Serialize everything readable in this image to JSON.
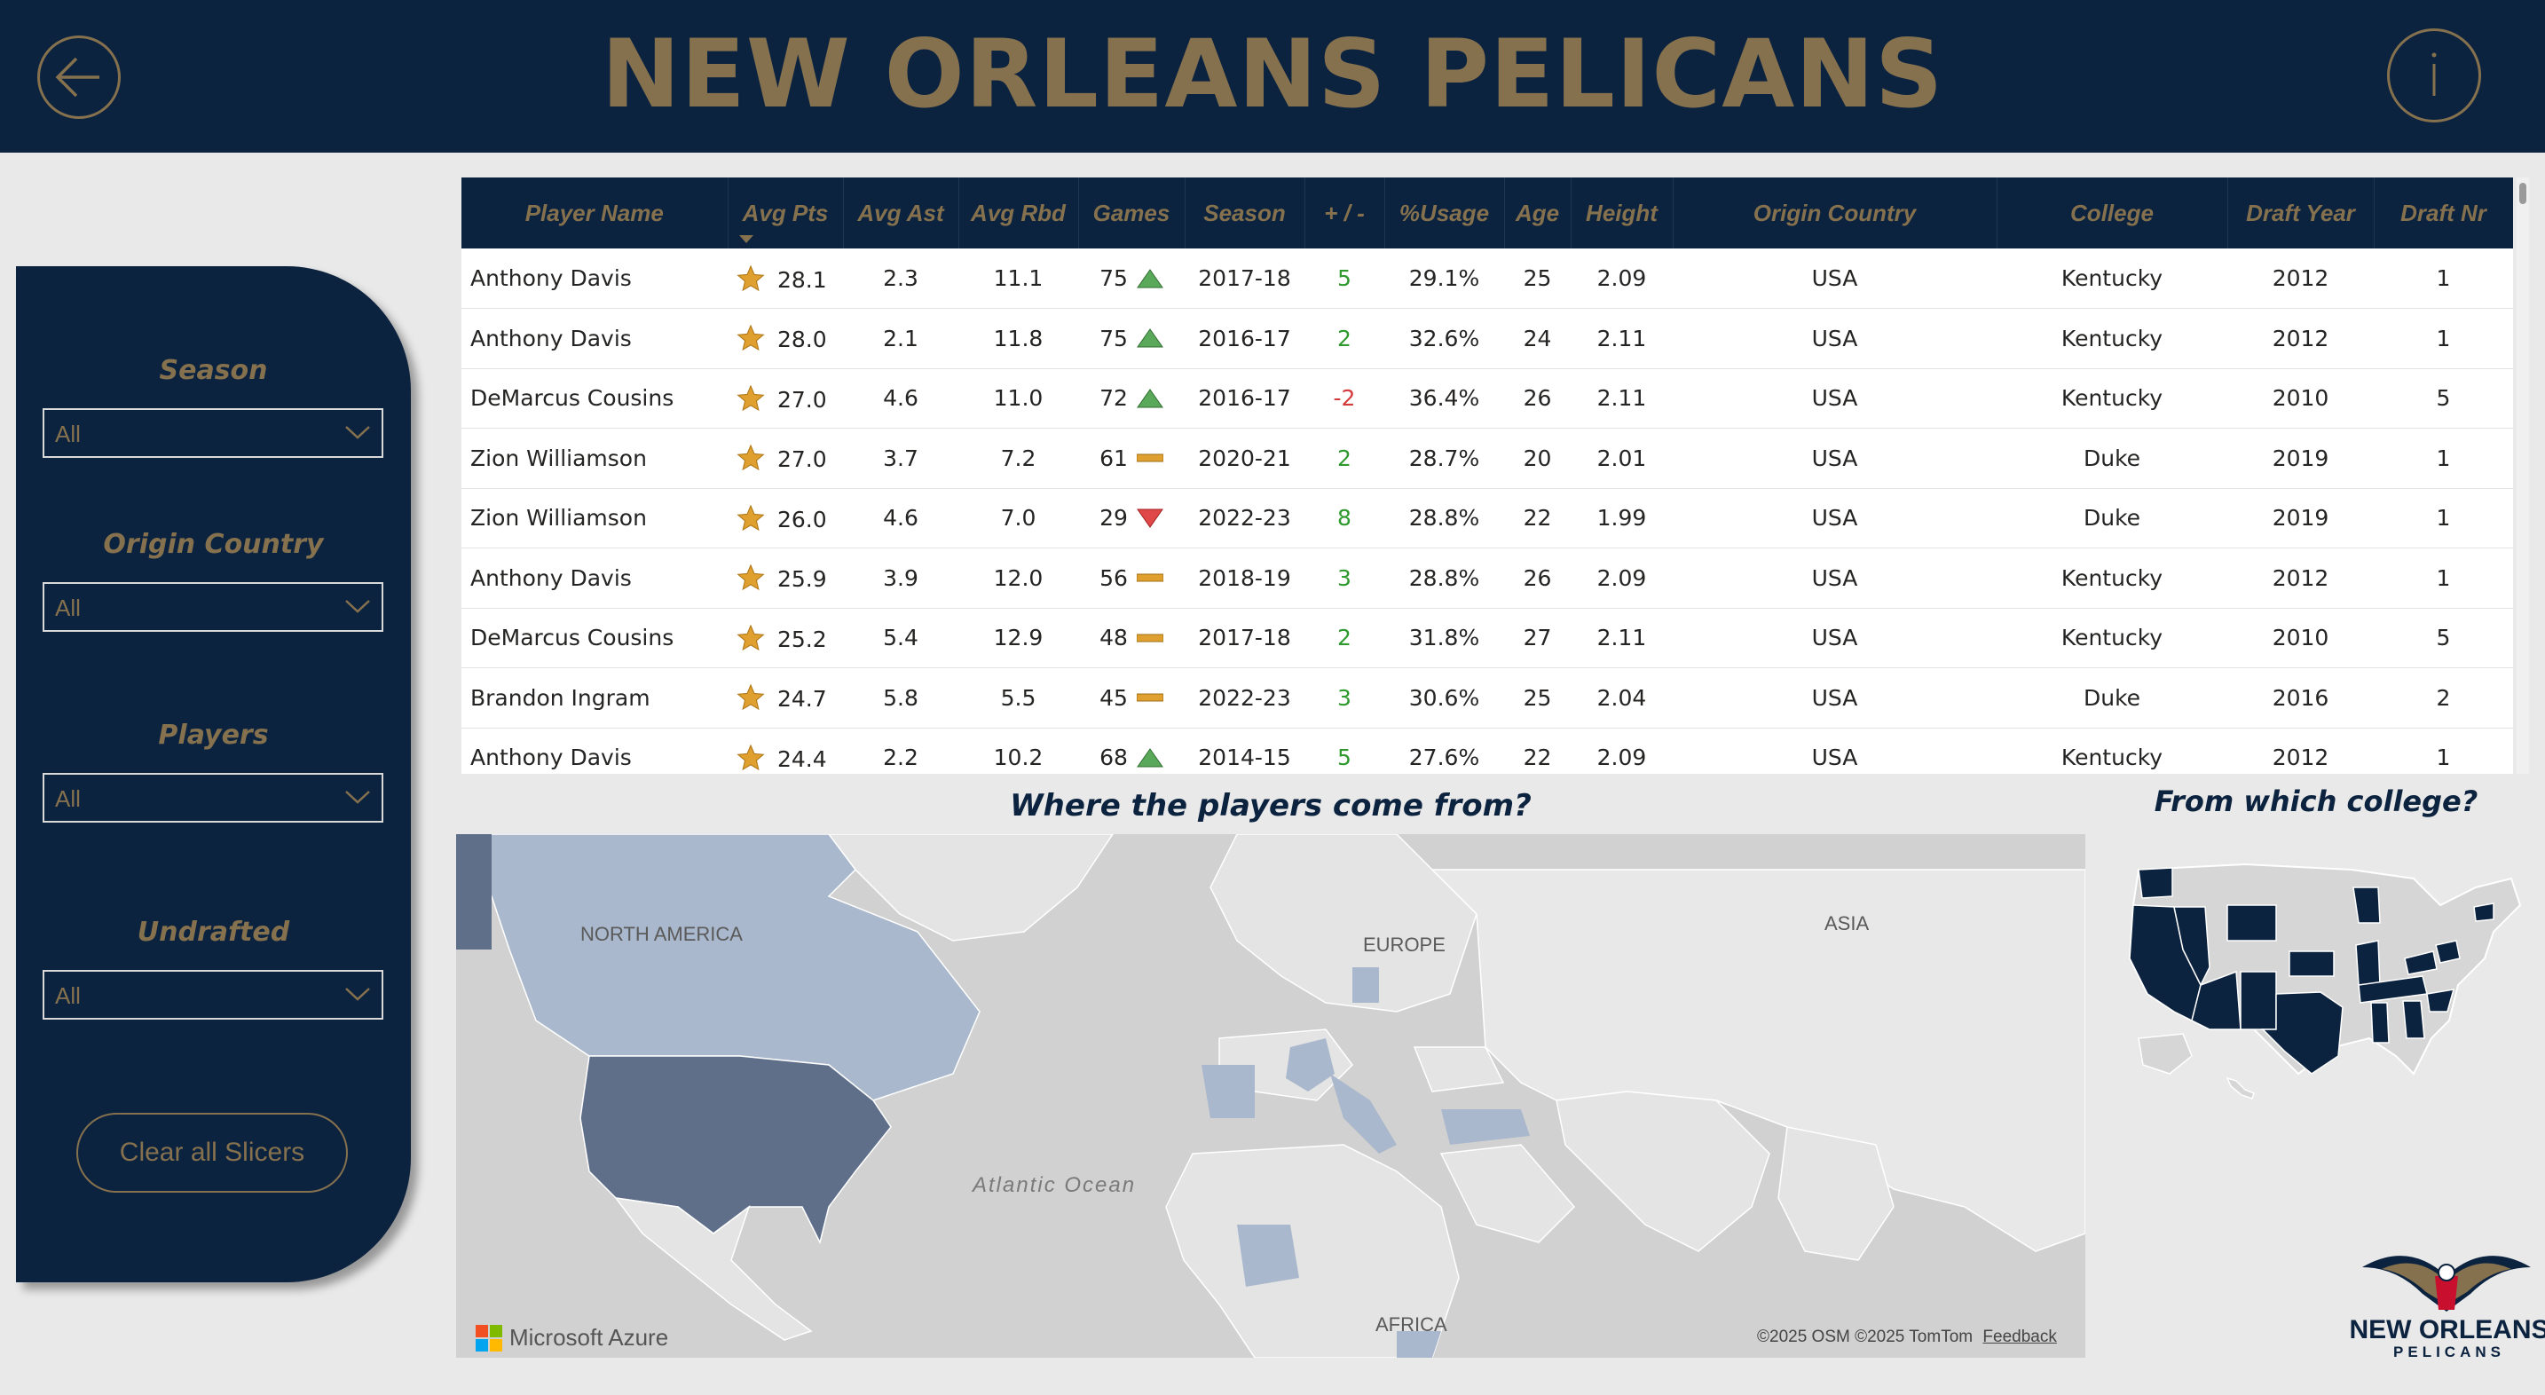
{
  "header": {
    "title": "NEW ORLEANS PELICANS",
    "back_icon": "back-arrow-icon",
    "info_icon": "info-icon"
  },
  "colors": {
    "navy": "#0c2340",
    "gold": "#85714d",
    "positive": "#2e9a2e",
    "negative": "#d43a3a"
  },
  "slicers": [
    {
      "label": "Season",
      "value": "All"
    },
    {
      "label": "Origin Country",
      "value": "All"
    },
    {
      "label": "Players",
      "value": "All"
    },
    {
      "label": "Undrafted",
      "value": "All"
    }
  ],
  "clear_button": "Clear all Slicers",
  "table": {
    "columns": [
      "Player Name",
      "Avg Pts",
      "Avg Ast",
      "Avg Rbd",
      "Games",
      "Season",
      "+ / -",
      "%Usage",
      "Age",
      "Height",
      "Origin Country",
      "College",
      "Draft Year",
      "Draft Nr"
    ],
    "rows": [
      {
        "player": "Anthony Davis",
        "pts": "28.1",
        "ast": "2.3",
        "rbd": "11.1",
        "games": "75",
        "trend": "up",
        "season": "2017-18",
        "pm": "5",
        "usage": "29.1%",
        "age": "25",
        "height": "2.09",
        "country": "USA",
        "college": "Kentucky",
        "draft_year": "2012",
        "draft_nr": "1"
      },
      {
        "player": "Anthony Davis",
        "pts": "28.0",
        "ast": "2.1",
        "rbd": "11.8",
        "games": "75",
        "trend": "up",
        "season": "2016-17",
        "pm": "2",
        "usage": "32.6%",
        "age": "24",
        "height": "2.11",
        "country": "USA",
        "college": "Kentucky",
        "draft_year": "2012",
        "draft_nr": "1"
      },
      {
        "player": "DeMarcus Cousins",
        "pts": "27.0",
        "ast": "4.6",
        "rbd": "11.0",
        "games": "72",
        "trend": "up",
        "season": "2016-17",
        "pm": "-2",
        "usage": "36.4%",
        "age": "26",
        "height": "2.11",
        "country": "USA",
        "college": "Kentucky",
        "draft_year": "2010",
        "draft_nr": "5"
      },
      {
        "player": "Zion Williamson",
        "pts": "27.0",
        "ast": "3.7",
        "rbd": "7.2",
        "games": "61",
        "trend": "flat",
        "season": "2020-21",
        "pm": "2",
        "usage": "28.7%",
        "age": "20",
        "height": "2.01",
        "country": "USA",
        "college": "Duke",
        "draft_year": "2019",
        "draft_nr": "1"
      },
      {
        "player": "Zion Williamson",
        "pts": "26.0",
        "ast": "4.6",
        "rbd": "7.0",
        "games": "29",
        "trend": "down",
        "season": "2022-23",
        "pm": "8",
        "usage": "28.8%",
        "age": "22",
        "height": "1.99",
        "country": "USA",
        "college": "Duke",
        "draft_year": "2019",
        "draft_nr": "1"
      },
      {
        "player": "Anthony Davis",
        "pts": "25.9",
        "ast": "3.9",
        "rbd": "12.0",
        "games": "56",
        "trend": "flat",
        "season": "2018-19",
        "pm": "3",
        "usage": "28.8%",
        "age": "26",
        "height": "2.09",
        "country": "USA",
        "college": "Kentucky",
        "draft_year": "2012",
        "draft_nr": "1"
      },
      {
        "player": "DeMarcus Cousins",
        "pts": "25.2",
        "ast": "5.4",
        "rbd": "12.9",
        "games": "48",
        "trend": "flat",
        "season": "2017-18",
        "pm": "2",
        "usage": "31.8%",
        "age": "27",
        "height": "2.11",
        "country": "USA",
        "college": "Kentucky",
        "draft_year": "2010",
        "draft_nr": "5"
      },
      {
        "player": "Brandon Ingram",
        "pts": "24.7",
        "ast": "5.8",
        "rbd": "5.5",
        "games": "45",
        "trend": "flat",
        "season": "2022-23",
        "pm": "3",
        "usage": "30.6%",
        "age": "25",
        "height": "2.04",
        "country": "USA",
        "college": "Duke",
        "draft_year": "2016",
        "draft_nr": "2"
      },
      {
        "player": "Anthony Davis",
        "pts": "24.4",
        "ast": "2.2",
        "rbd": "10.2",
        "games": "68",
        "trend": "up",
        "season": "2014-15",
        "pm": "5",
        "usage": "27.6%",
        "age": "22",
        "height": "2.09",
        "country": "USA",
        "college": "Kentucky",
        "draft_year": "2012",
        "draft_nr": "1"
      }
    ]
  },
  "map": {
    "title": "Where the players come from?",
    "labels": {
      "north_america": "NORTH AMERICA",
      "europe": "EUROPE",
      "asia": "ASIA",
      "africa": "AFRICA",
      "ocean": "Atlantic Ocean"
    },
    "brand": "Microsoft Azure",
    "attribution": "©2025 OSM  ©2025 TomTom",
    "feedback": "Feedback"
  },
  "college_map": {
    "title": "From which college?"
  },
  "team_logo": {
    "name": "NEW ORLEANS",
    "sub": "PELICANS"
  }
}
